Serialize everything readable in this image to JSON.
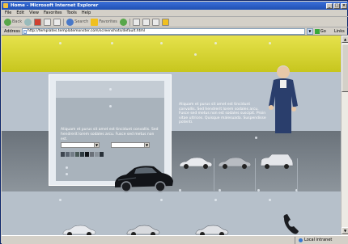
{
  "window": {
    "title": "Home - Microsoft Internet Explorer",
    "minimize": "_",
    "maximize": "□",
    "close": "×"
  },
  "menu": [
    "File",
    "Edit",
    "View",
    "Favorites",
    "Tools",
    "Help"
  ],
  "toolbar": {
    "back": "Back",
    "search": "Search",
    "favorites": "Favorites"
  },
  "address": {
    "label": "Address",
    "value": "http://templates.templatemonster.com/screenshots/default.html",
    "go": "Go",
    "links": "Links"
  },
  "panel": {
    "text": "Aliquam et purus sit amet est tincidunt convallis. Sed hendrerit lorem sodales arcu. Fusce sed metus non est."
  },
  "right_text": "Aliquam et purus sit amet est tincidunt convallis. Sed hendrerit lorem sodales arcu. Fusce sed metus non est sodales suscipit. Proin vitae ultrices. Quisque malesuada. Suspendisse potenti.",
  "swatch_colors": [
    "#3e4650",
    "#5a6470",
    "#747e88",
    "#4a5a58",
    "#2e3a40",
    "#101418",
    "#6a7078",
    "#8a929a",
    "#283038"
  ],
  "status": {
    "left": "",
    "zone": "Local intranet"
  }
}
